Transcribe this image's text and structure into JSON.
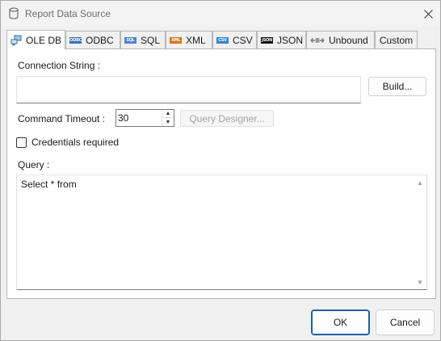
{
  "window": {
    "title": "Report Data Source",
    "icon": "database-icon",
    "close_icon": "close-icon"
  },
  "tabs": [
    {
      "label": "OLE DB",
      "icon": "ole-db-icon",
      "active": true
    },
    {
      "label": "ODBC",
      "icon": "odbc-icon",
      "badge": "ODBC",
      "badge_color": "#3b6db5"
    },
    {
      "label": "SQL",
      "icon": "sql-icon",
      "badge": "SQL",
      "badge_color": "#4a86c8"
    },
    {
      "label": "XML",
      "icon": "xml-icon",
      "badge": "XML",
      "badge_color": "#d9731b"
    },
    {
      "label": "CSV",
      "icon": "csv-icon",
      "badge": "CSV",
      "badge_color": "#2f88c9"
    },
    {
      "label": "JSON",
      "icon": "json-icon",
      "badge": "JSON",
      "badge_color": "#111111"
    },
    {
      "label": "Unbound",
      "icon": "unbound-icon"
    },
    {
      "label": "Custom"
    }
  ],
  "connection": {
    "label": "Connection String :",
    "value": "",
    "build_label": "Build..."
  },
  "command": {
    "timeout_label": "Command Timeout :",
    "timeout_value": "30",
    "query_designer_label": "Query Designer..."
  },
  "credentials": {
    "label": "Credentials required",
    "checked": false
  },
  "query": {
    "label": "Query :",
    "value": "Select * from"
  },
  "footer": {
    "ok_label": "OK",
    "cancel_label": "Cancel"
  }
}
